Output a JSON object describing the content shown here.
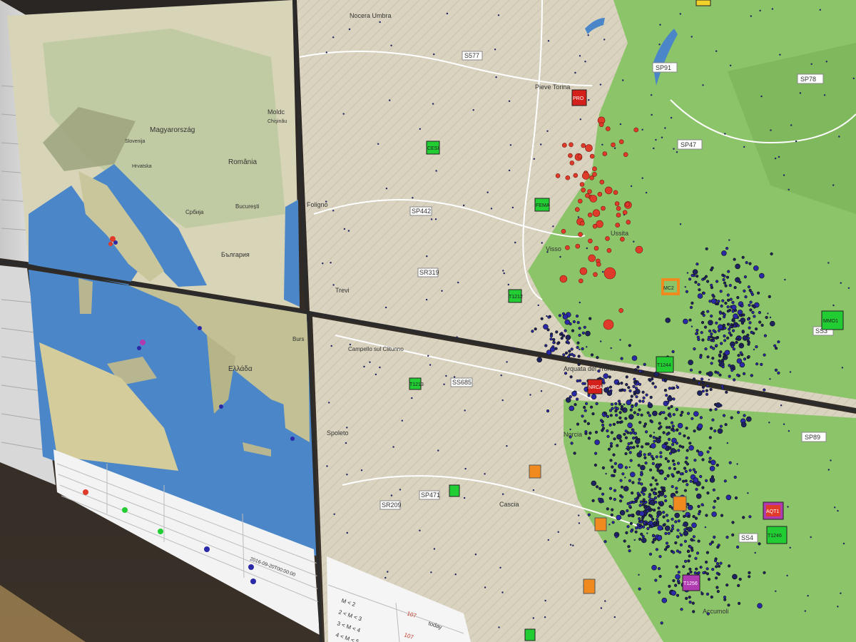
{
  "scene": {
    "description_free": true
  },
  "overview_map": {
    "place_labels": [
      "Magyarország",
      "România",
      "Moldc",
      "Chişinău",
      "București",
      "Србија",
      "България",
      "Hrvatska",
      "Slovenija",
      "Ελλάδα",
      "Burs"
    ]
  },
  "detail_map": {
    "place_labels": [
      "Nocera Umbra",
      "Pieve Torina",
      "Foligno",
      "Visso",
      "Ussita",
      "Trevi",
      "Campello sul Clitunno",
      "Spoleto",
      "Norcia",
      "Cascia",
      "Arquata del Tronto",
      "Accumoli"
    ],
    "road_labels": [
      "SP91",
      "SP78",
      "SP47",
      "S577",
      "SS3",
      "SP442",
      "SR319",
      "SS685",
      "SR209",
      "SP471",
      "SP89",
      "SS4"
    ],
    "station_labels": [
      "MC2",
      "MMO1",
      "T1244",
      "AQT1",
      "T1246",
      "T1256",
      "FEMA",
      "CESI",
      "T1212",
      "T1213",
      "NRCA",
      "PRO"
    ]
  },
  "legend": {
    "magnitude_rows": [
      "M < 2",
      "2 < M < 3",
      "3 < M < 4",
      "4 < M < 5"
    ],
    "counts": [
      "107",
      "107"
    ],
    "period_label": "today",
    "timestamp": "2016-09-20T00:00:00"
  },
  "colors": {
    "sea": "#4a86c8",
    "terrain_green": "#8cc46a",
    "terrain_tan": "#d9d3bf",
    "quake_recent": "#e03a2a",
    "quake_older": "#2a2aa8",
    "station_green": "#22cc33",
    "station_orange": "#f08a1e",
    "station_red": "#d3201a",
    "station_purple": "#b03ab0"
  }
}
